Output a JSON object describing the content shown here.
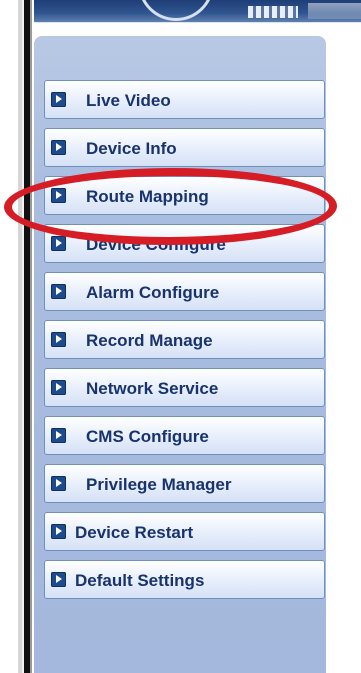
{
  "menu": {
    "items": [
      {
        "label": "Live Video",
        "icon": "arrow-right-icon"
      },
      {
        "label": "Device Info",
        "icon": "arrow-right-icon"
      },
      {
        "label": "Route Mapping",
        "icon": "arrow-right-icon"
      },
      {
        "label": "Device Configure",
        "icon": "arrow-right-icon"
      },
      {
        "label": "Alarm Configure",
        "icon": "arrow-right-icon"
      },
      {
        "label": "Record Manage",
        "icon": "arrow-right-icon"
      },
      {
        "label": "Network Service",
        "icon": "arrow-right-icon"
      },
      {
        "label": "CMS Configure",
        "icon": "arrow-right-icon"
      },
      {
        "label": "Privilege Manager",
        "icon": "arrow-right-icon"
      },
      {
        "label": "Device Restart",
        "icon": "arrow-right-icon"
      },
      {
        "label": "Default Settings",
        "icon": "arrow-right-icon"
      }
    ]
  },
  "highlight": {
    "target": "Route Mapping",
    "color": "#d61c25"
  },
  "colors": {
    "panel_bg": "#a9bddf",
    "button_border": "#6f8fc1",
    "text": "#19336f",
    "icon": "#1d4c8c"
  }
}
